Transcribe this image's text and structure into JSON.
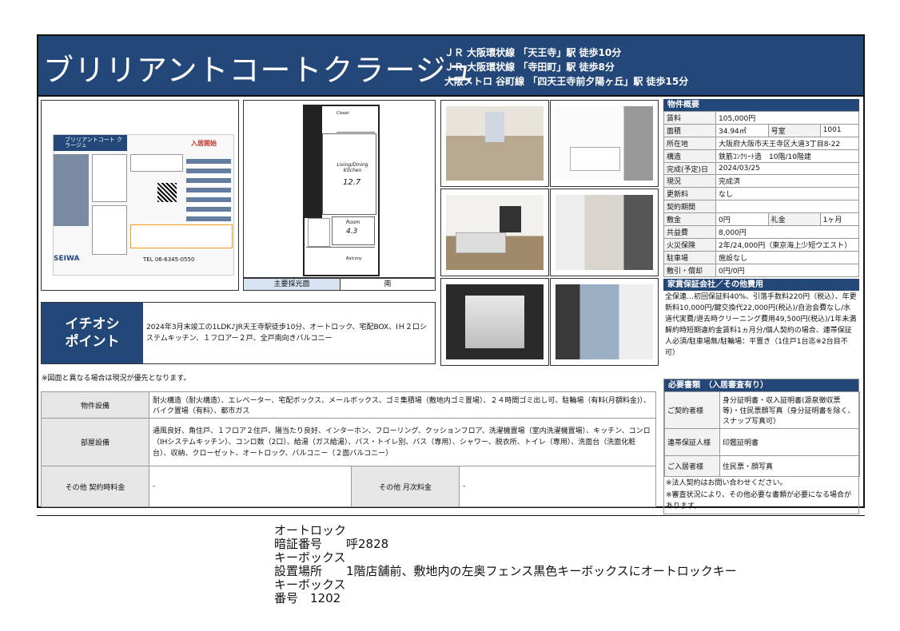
{
  "header": {
    "title": "ブリリアントコートクラージュ",
    "stations": [
      "ＪＲ 大阪環状線 「天王寺」駅 徒歩10分",
      "ＪＲ 大阪環状線 「寺田町」駅 徒歩8分",
      "大阪メトロ 谷町線 「四天王寺前夕陽ヶ丘」駅 徒歩15分"
    ]
  },
  "flyer": {
    "title": "ブリリアントコート クラージュ",
    "badge": "入居開始",
    "phone": "TEL 06-6345-0550",
    "company": "SEIWA"
  },
  "floorplan": {
    "living_label": "Living/Dining Kitchen",
    "living_size": "12.7",
    "bedroom_label": "Room",
    "bedroom_size": "4.3",
    "balcony": "Balcony",
    "closet": "Closet",
    "light_label": "主要採光面",
    "light_value": "南"
  },
  "overview": {
    "title": "物件概要",
    "rent_label": "賃料",
    "rent": "105,000円",
    "area_label": "面積",
    "area": "34.94㎡",
    "room_label": "号室",
    "room": "1001",
    "address_label": "所在地",
    "address": "大阪府大阪市天王寺区大道3丁目8-22",
    "structure_label": "構造",
    "structure": "鉄筋ｺﾝｸﾘｰﾄ造　10階/10階建",
    "built_label": "完成(予定)日",
    "built": "2024/03/25",
    "status_label": "現況",
    "status": "完成済",
    "renewal_label": "更新料",
    "renewal": "なし",
    "term_label": "契約期間",
    "term": "",
    "deposit_label": "敷金",
    "deposit": "0円",
    "key_label": "礼金",
    "key": "1ヶ月",
    "common_label": "共益費",
    "common": "8,000円",
    "insurance_label": "火災保険",
    "insurance": "2年/24,000円（東京海上少短ウエスト）",
    "parking_label": "駐車場",
    "parking": "施設なし",
    "shikibiki_label": "敷引・償却",
    "shikibiki": "0円/0円"
  },
  "guarantee": {
    "title": "家賃保証会社／その他費用",
    "text": "全保連…初回保証料40%、引落手数料220円（税込）、年更新料10,000円/鍵交換代22,000円(税込)/自治会費なし/水道代実費/退去時クリーニング費用49,500円(税込)/1年未満解約時短期違約金賃料1ヵ月分/個人契約の場合、連帯保証人必須/駐車場無/駐輪場：平置き（1住戸1台迄※2台目不可）"
  },
  "docs": {
    "title": "必要書類　（入居審査有り）",
    "rows": [
      {
        "k": "ご契約者様",
        "v": "身分証明書・収入証明書(源泉徴収票等)・住民票顔写真（身分証明書を除く、スナップ写真可）"
      },
      {
        "k": "連帯保証人様",
        "v": "印鑑証明書"
      },
      {
        "k": "ご入居者様",
        "v": "住民票・顔写真"
      }
    ],
    "notes": [
      "※法人契約はお問い合わせください。",
      "※審査状況により、その他必要な書類が必要になる場合があります。"
    ]
  },
  "ichioshi": {
    "label_line1": "イチオシ",
    "label_line2": "ポイント",
    "text": "2024年3月末竣工の1LDK♪JR天王寺駅徒歩10分、オートロック、宅配BOX、IＨ２口システムキッチン、１フロアー２戸、全戸南向きバルコニー"
  },
  "note_priority": "※図面と異なる場合は現況が優先となります。",
  "facilities": {
    "building_label": "物件設備",
    "building": "耐火構造（耐火構造）、エレベーター、宅配ボックス、メールボックス、ゴミ集積場（敷地内ゴミ置場）、２４時間ゴミ出し可、駐輪場（有料(月額料金)）、バイク置場（有料）、都市ガス",
    "room_label": "部屋設備",
    "room": "通風良好、角住戸、１フロア２住戸、陽当たり良好、インターホン、フローリング、クッションフロア、洗濯機置場（室内洗濯機置場）、キッチン、コンロ（IHシステムキッチン）、コンロ数（2口）、給湯（ガス給湯）、バス・トイレ別、バス（専用）、シャワー、脱衣所、トイレ（専用）、洗面台（洗面化粧台）、収納、クローゼット、オートロック、バルコニー（２面バルコニー）",
    "other_contract_label": "その他 契約時料金",
    "other_contract": "-",
    "other_monthly_label": "その他 月次料金",
    "other_monthly": "-"
  },
  "bottom": "オートロック\n暗証番号　　呼2828\nキーボックス\n設置場所　　1階店舗前、敷地内の左奥フェンス黒色キーボックスにオートロックキー\nキーボックス\n番号　1202"
}
